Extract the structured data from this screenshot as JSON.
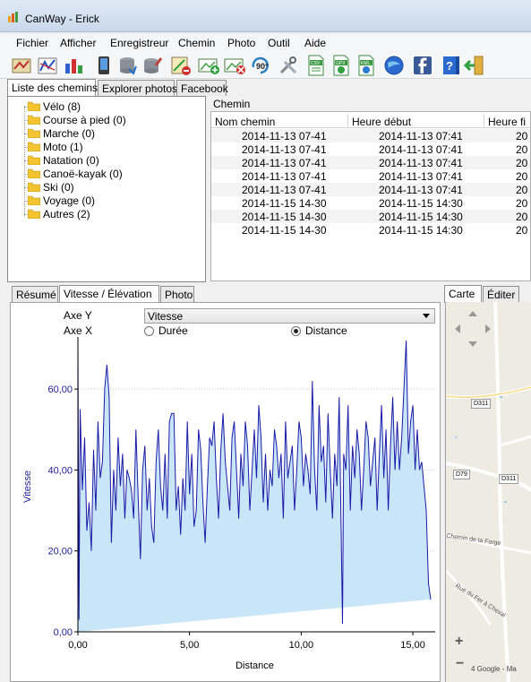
{
  "window": {
    "title": "CanWay - Erick"
  },
  "menu": [
    "Fichier",
    "Afficher",
    "Enregistreur",
    "Chemin",
    "Photo",
    "Outil",
    "Aide"
  ],
  "toolbar_icons": [
    "map-icon",
    "route-icon",
    "bar-chart-icon",
    "phone-icon",
    "database-icon",
    "database-edit-icon",
    "map-pin-icon",
    "photo-add-icon",
    "photo-remove-icon",
    "rotate-90-icon",
    "tools-icon",
    "csv-file-icon",
    "gpx-file-icon",
    "kml-file-icon",
    "google-earth-icon",
    "facebook-icon",
    "help-icon",
    "exit-icon"
  ],
  "top_tabs": [
    "Liste des chemins",
    "Explorer photos",
    "Facebook"
  ],
  "tree": [
    {
      "label": "Vélo (8)"
    },
    {
      "label": "Course à pied (0)"
    },
    {
      "label": "Marche (0)"
    },
    {
      "label": "Moto (1)"
    },
    {
      "label": "Natation (0)"
    },
    {
      "label": "Canoë-kayak (0)"
    },
    {
      "label": "Ski (0)"
    },
    {
      "label": "Voyage (0)"
    },
    {
      "label": "Autres (2)"
    }
  ],
  "chemin": {
    "group_label": "Chemin",
    "columns": [
      "Nom chemin",
      "Heure début",
      "Heure fi"
    ],
    "rows": [
      [
        "2014-11-13 07-41",
        "2014-11-13 07:41",
        "20"
      ],
      [
        "2014-11-13 07-41",
        "2014-11-13 07:41",
        "20"
      ],
      [
        "2014-11-13 07-41",
        "2014-11-13 07:41",
        "20"
      ],
      [
        "2014-11-13 07-41",
        "2014-11-13 07:41",
        "20"
      ],
      [
        "2014-11-13 07-41",
        "2014-11-13 07:41",
        "20"
      ],
      [
        "2014-11-15 14-30",
        "2014-11-15 14:30",
        "20"
      ],
      [
        "2014-11-15 14-30",
        "2014-11-15 14:30",
        "20"
      ],
      [
        "2014-11-15 14-30",
        "2014-11-15 14:30",
        "20"
      ]
    ]
  },
  "mid_tabs": [
    "Résumé",
    "Vitesse / Élévation",
    "Photo"
  ],
  "controls": {
    "axe_y_label": "Axe Y",
    "axe_x_label": "Axe X",
    "axe_y_value": "Vitesse",
    "option_duree": "Durée",
    "option_distance": "Distance",
    "selected": "Distance"
  },
  "map": {
    "tabs": [
      "Carte",
      "Éditer"
    ],
    "road_labels": [
      "D311",
      "D311",
      "D79"
    ],
    "street_labels": [
      "Chemin de la Forge",
      "Rue du Fer à Cheval"
    ],
    "zoom_in": "+",
    "zoom_out": "−",
    "attribution": "4 Google - Ma"
  },
  "chart_data": {
    "type": "area",
    "xlabel": "Distance",
    "ylabel": "Vitesse",
    "xlim": [
      0,
      16
    ],
    "ylim": [
      0,
      72
    ],
    "xticks": [
      "0,00",
      "5,00",
      "10,00",
      "15,00"
    ],
    "yticks": [
      "0,00",
      "20,00",
      "40,00",
      "60,00"
    ],
    "grid": true,
    "colors": {
      "line": "#1a1aa8",
      "fill": "#c8e6f8"
    },
    "x": [
      0.0,
      0.05,
      0.1,
      0.2,
      0.3,
      0.4,
      0.5,
      0.6,
      0.7,
      0.8,
      0.9,
      1.0,
      1.1,
      1.2,
      1.3,
      1.4,
      1.5,
      1.6,
      1.7,
      1.8,
      1.9,
      2.0,
      2.1,
      2.2,
      2.3,
      2.4,
      2.5,
      2.6,
      2.7,
      2.8,
      2.9,
      3.0,
      3.1,
      3.2,
      3.3,
      3.4,
      3.5,
      3.6,
      3.7,
      3.8,
      3.9,
      4.0,
      4.1,
      4.2,
      4.3,
      4.4,
      4.5,
      4.6,
      4.7,
      4.8,
      4.9,
      5.0,
      5.1,
      5.2,
      5.3,
      5.4,
      5.5,
      5.6,
      5.7,
      5.8,
      5.9,
      6.0,
      6.1,
      6.2,
      6.3,
      6.4,
      6.5,
      6.6,
      6.7,
      6.8,
      6.9,
      7.0,
      7.1,
      7.2,
      7.3,
      7.4,
      7.5,
      7.6,
      7.7,
      7.8,
      7.9,
      8.0,
      8.1,
      8.2,
      8.3,
      8.4,
      8.5,
      8.6,
      8.7,
      8.8,
      8.9,
      9.0,
      9.1,
      9.2,
      9.3,
      9.4,
      9.5,
      9.6,
      9.7,
      9.8,
      9.9,
      10.0,
      10.1,
      10.2,
      10.3,
      10.4,
      10.5,
      10.6,
      10.7,
      10.8,
      10.9,
      11.0,
      11.1,
      11.2,
      11.3,
      11.4,
      11.5,
      11.6,
      11.7,
      11.8,
      11.85,
      11.9,
      12.0,
      12.1,
      12.2,
      12.3,
      12.4,
      12.5,
      12.6,
      12.7,
      12.8,
      12.9,
      13.0,
      13.1,
      13.2,
      13.3,
      13.4,
      13.5,
      13.6,
      13.7,
      13.8,
      13.9,
      14.0,
      14.1,
      14.2,
      14.3,
      14.4,
      14.5,
      14.6,
      14.7,
      14.8,
      14.9,
      15.0,
      15.1,
      15.2,
      15.3,
      15.4,
      15.5,
      15.6,
      15.7,
      15.8,
      15.85,
      15.9
    ],
    "y": [
      72,
      3,
      55,
      35,
      48,
      25,
      32,
      20,
      45,
      30,
      52,
      38,
      42,
      60,
      66,
      58,
      22,
      40,
      30,
      48,
      36,
      44,
      28,
      40,
      38,
      35,
      28,
      50,
      33,
      18,
      40,
      46,
      30,
      38,
      26,
      22,
      42,
      50,
      36,
      30,
      44,
      28,
      52,
      54,
      54,
      30,
      36,
      24,
      38,
      30,
      52,
      34,
      44,
      26,
      30,
      50,
      45,
      32,
      22,
      36,
      48,
      46,
      52,
      38,
      28,
      45,
      54,
      42,
      36,
      30,
      48,
      52,
      40,
      28,
      44,
      36,
      52,
      46,
      30,
      40,
      50,
      38,
      56,
      48,
      32,
      44,
      30,
      40,
      36,
      50,
      46,
      38,
      44,
      28,
      52,
      38,
      42,
      46,
      30,
      40,
      52,
      48,
      36,
      44,
      40,
      34,
      62,
      40,
      30,
      56,
      42,
      46,
      32,
      54,
      40,
      28,
      44,
      36,
      58,
      20,
      2,
      44,
      40,
      56,
      30,
      46,
      38,
      50,
      44,
      30,
      40,
      52,
      48,
      36,
      42,
      48,
      30,
      44,
      56,
      38,
      50,
      30,
      46,
      58,
      40,
      52,
      40,
      48,
      60,
      72,
      44,
      52,
      56,
      40,
      50,
      40,
      42,
      36,
      30,
      12,
      8
    ]
  }
}
